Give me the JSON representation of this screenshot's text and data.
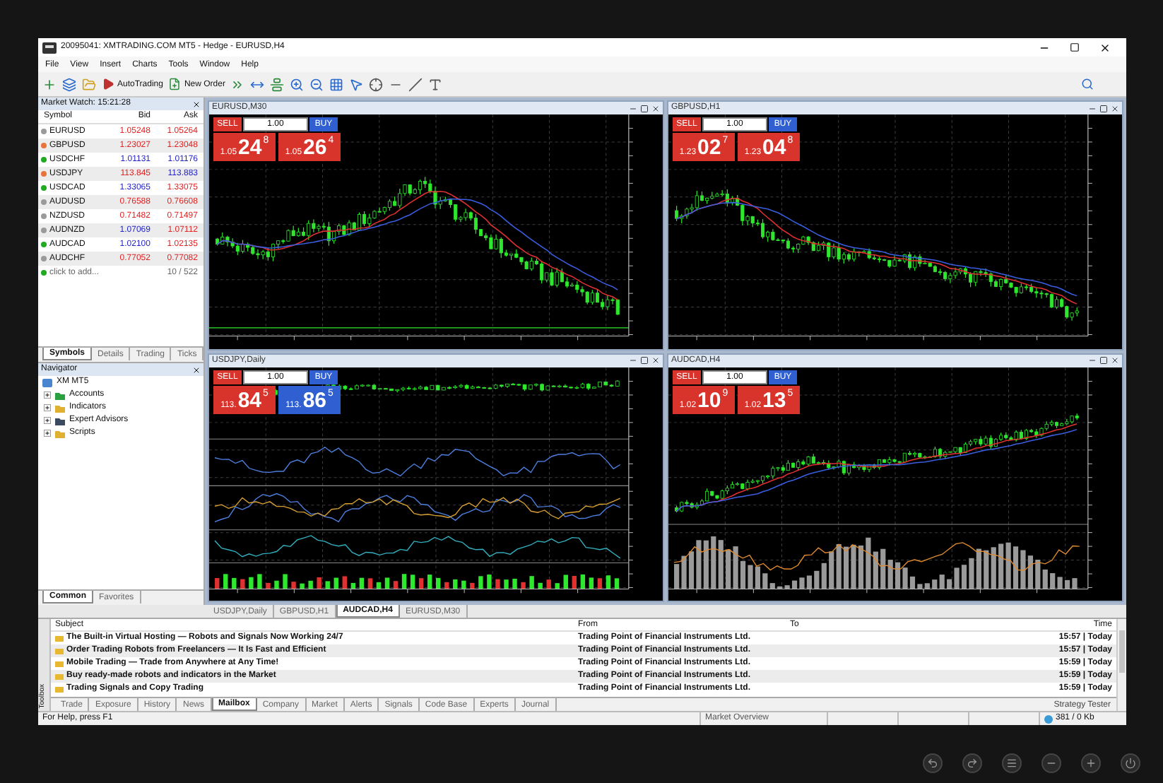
{
  "window": {
    "title": "20095041: XMTRADING.COM MT5 - Hedge - EURUSD,H4"
  },
  "menu": [
    "File",
    "View",
    "Insert",
    "Charts",
    "Tools",
    "Window",
    "Help"
  ],
  "toolbar": {
    "autotrading": "AutoTrading",
    "new_order": "New Order"
  },
  "market_watch": {
    "title": "Market Watch: 15:21:28",
    "columns": [
      "Symbol",
      "Bid",
      "Ask"
    ],
    "rows": [
      {
        "symbol": "EURUSD",
        "color": "#9a9a9a",
        "bid": {
          "value": "1.05248",
          "color": "#e02424"
        },
        "ask": {
          "value": "1.05264",
          "color": "#e02424"
        }
      },
      {
        "symbol": "GBPUSD",
        "color": "#e8743b",
        "bid": {
          "value": "1.23027",
          "color": "#e02424"
        },
        "ask": {
          "value": "1.23048",
          "color": "#e02424"
        }
      },
      {
        "symbol": "USDCHF",
        "color": "#22aa22",
        "bid": {
          "value": "1.01131",
          "color": "#2323cc"
        },
        "ask": {
          "value": "1.01176",
          "color": "#2323cc"
        }
      },
      {
        "symbol": "USDJPY",
        "color": "#e8743b",
        "bid": {
          "value": "113.845",
          "color": "#e02424"
        },
        "ask": {
          "value": "113.883",
          "color": "#2323cc"
        }
      },
      {
        "symbol": "USDCAD",
        "color": "#22aa22",
        "bid": {
          "value": "1.33065",
          "color": "#2323cc"
        },
        "ask": {
          "value": "1.33075",
          "color": "#e02424"
        }
      },
      {
        "symbol": "AUDUSD",
        "color": "#9a9a9a",
        "bid": {
          "value": "0.76588",
          "color": "#e02424"
        },
        "ask": {
          "value": "0.76608",
          "color": "#e02424"
        }
      },
      {
        "symbol": "NZDUSD",
        "color": "#9a9a9a",
        "bid": {
          "value": "0.71482",
          "color": "#e02424"
        },
        "ask": {
          "value": "0.71497",
          "color": "#e02424"
        }
      },
      {
        "symbol": "AUDNZD",
        "color": "#9a9a9a",
        "bid": {
          "value": "1.07069",
          "color": "#2323cc"
        },
        "ask": {
          "value": "1.07112",
          "color": "#e02424"
        }
      },
      {
        "symbol": "AUDCAD",
        "color": "#22aa22",
        "bid": {
          "value": "1.02100",
          "color": "#2323cc"
        },
        "ask": {
          "value": "1.02135",
          "color": "#e02424"
        }
      },
      {
        "symbol": "AUDCHF",
        "color": "#9a9a9a",
        "bid": {
          "value": "0.77052",
          "color": "#e02424"
        },
        "ask": {
          "value": "0.77082",
          "color": "#e02424"
        }
      }
    ],
    "add_row": {
      "label": "click to add...",
      "color": "#22aa22",
      "count": "10 / 522"
    },
    "tabs": [
      {
        "label": "Symbols",
        "selected": true
      },
      {
        "label": "Details",
        "selected": false
      },
      {
        "label": "Trading",
        "selected": false
      },
      {
        "label": "Ticks",
        "selected": false
      }
    ]
  },
  "navigator": {
    "title": "Navigator",
    "root": "XM MT5",
    "children": [
      {
        "label": "Accounts",
        "expanded": false
      },
      {
        "label": "Indicators",
        "expanded": false
      },
      {
        "label": "Expert Advisors",
        "expanded": false
      },
      {
        "label": "Scripts",
        "expanded": false
      }
    ],
    "tabs": [
      {
        "label": "Common",
        "selected": true
      },
      {
        "label": "Favorites",
        "selected": false
      }
    ]
  },
  "charts": [
    {
      "title": "EURUSD,M30",
      "kind": "price",
      "sell": "SELL",
      "buy": "BUY",
      "lot": "1.00",
      "bid": {
        "prefix": "1.05",
        "big": "24",
        "small": "8",
        "color": "#d9342b"
      },
      "ask": {
        "prefix": "1.05",
        "big": "26",
        "small": "4",
        "color": "#d9342b"
      }
    },
    {
      "title": "GBPUSD,H1",
      "kind": "price",
      "sell": "SELL",
      "buy": "BUY",
      "lot": "1.00",
      "bid": {
        "prefix": "1.23",
        "big": "02",
        "small": "7",
        "color": "#d9342b"
      },
      "ask": {
        "prefix": "1.23",
        "big": "04",
        "small": "8",
        "color": "#d9342b"
      }
    },
    {
      "title": "USDJPY,Daily",
      "kind": "indicators",
      "sell": "SELL",
      "buy": "BUY",
      "lot": "1.00",
      "bid": {
        "prefix": "113.",
        "big": "84",
        "small": "5",
        "color": "#d9342b"
      },
      "ask": {
        "prefix": "113.",
        "big": "86",
        "small": "5",
        "color": "#2f5fd0"
      }
    },
    {
      "title": "AUDCAD,H4",
      "kind": "histogram",
      "sell": "SELL",
      "buy": "BUY",
      "lot": "1.00",
      "bid": {
        "prefix": "1.02",
        "big": "10",
        "small": "9",
        "color": "#d9342b"
      },
      "ask": {
        "prefix": "1.02",
        "big": "13",
        "small": "5",
        "color": "#d9342b"
      }
    }
  ],
  "chart_tabs": [
    {
      "label": "USDJPY,Daily",
      "selected": false
    },
    {
      "label": "GBPUSD,H1",
      "selected": false
    },
    {
      "label": "AUDCAD,H4",
      "selected": true
    },
    {
      "label": "EURUSD,M30",
      "selected": false
    }
  ],
  "toolbox": {
    "label": "Toolbox",
    "columns": [
      "Subject",
      "From",
      "To",
      "Time"
    ],
    "rows": [
      {
        "subject": "The Built-in Virtual Hosting — Robots and Signals Now Working 24/7",
        "from": "Trading Point of Financial Instruments Ltd.",
        "time": "15:57 | Today"
      },
      {
        "subject": "Order Trading Robots from Freelancers — It Is Fast and Efficient",
        "from": "Trading Point of Financial Instruments Ltd.",
        "time": "15:57 | Today"
      },
      {
        "subject": "Mobile Trading — Trade from Anywhere at Any Time!",
        "from": "Trading Point of Financial Instruments Ltd.",
        "time": "15:59 | Today"
      },
      {
        "subject": "Buy ready-made robots and indicators in the Market",
        "from": "Trading Point of Financial Instruments Ltd.",
        "time": "15:59 | Today"
      },
      {
        "subject": "Trading Signals and Copy Trading",
        "from": "Trading Point of Financial Instruments Ltd.",
        "time": "15:59 | Today"
      }
    ],
    "tabs": [
      {
        "label": "Trade",
        "selected": false
      },
      {
        "label": "Exposure",
        "selected": false
      },
      {
        "label": "History",
        "selected": false
      },
      {
        "label": "News",
        "selected": false
      },
      {
        "label": "Mailbox",
        "selected": true
      },
      {
        "label": "Company",
        "selected": false
      },
      {
        "label": "Market",
        "selected": false
      },
      {
        "label": "Alerts",
        "selected": false
      },
      {
        "label": "Signals",
        "selected": false
      },
      {
        "label": "Code Base",
        "selected": false
      },
      {
        "label": "Experts",
        "selected": false
      },
      {
        "label": "Journal",
        "selected": false
      }
    ],
    "strategy_tester": "Strategy Tester"
  },
  "status_bar": {
    "help": "For Help, press F1",
    "market": "Market Overview",
    "traffic": "381 / 0 Kb"
  }
}
